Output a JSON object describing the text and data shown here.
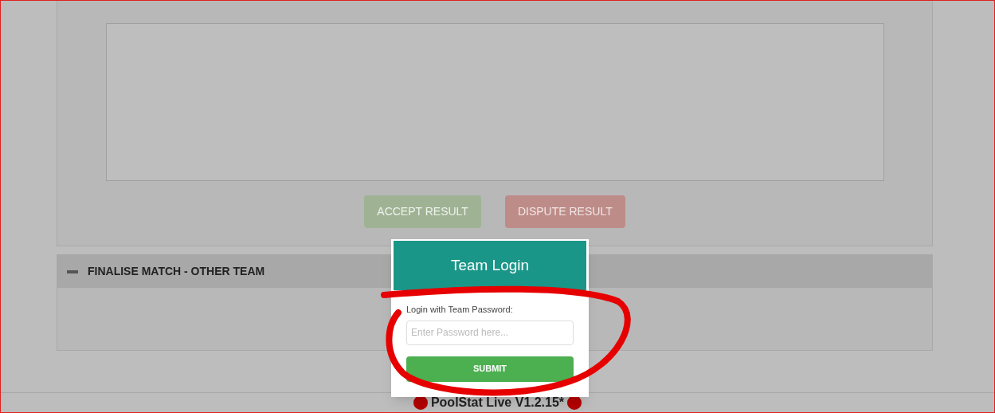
{
  "comment_panel": {
    "buttons": [
      {
        "label": "ACCEPT RESULT",
        "kind": "accept"
      },
      {
        "label": "DISPUTE RESULT",
        "kind": "dispute"
      }
    ]
  },
  "other_team_panel": {
    "title": "FINALISE MATCH - OTHER TEAM",
    "expanded": true
  },
  "footer": {
    "text": "PoolStat Live V1.2.15*"
  },
  "modal": {
    "title": "Team Login",
    "label": "Login with Team Password:",
    "password": {
      "placeholder": "Enter Password here..."
    },
    "submit": "SUBMIT"
  }
}
